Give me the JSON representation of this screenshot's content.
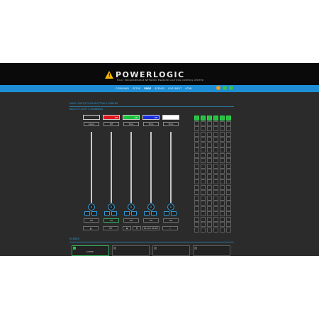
{
  "header": {
    "brand": "POWERLOGIC",
    "tagline": "FULLY PROGRAMMABLE NETWORK ENABLED LIGHTING CONTROL CENTER",
    "logo_mark": "warning-triangle-icon",
    "accent": "#1e8fd6"
  },
  "nav": {
    "items": [
      {
        "label": "COMMAND"
      },
      {
        "label": "SETUP"
      },
      {
        "label": "FADE",
        "active": true
      },
      {
        "label": "SCENES"
      },
      {
        "label": "LIVE INPUT"
      },
      {
        "label": "HTML"
      }
    ]
  },
  "social": [
    {
      "name": "facebook-icon",
      "color": "#f0a020"
    },
    {
      "name": "twitter-icon",
      "color": "#3cc04a"
    },
    {
      "name": "google-icon",
      "color": "#3cc04a"
    }
  ],
  "sections": {
    "top_title": "FADE LIGHT/COLOR BUTTON & FADERS",
    "top_subtitle": "SELECT LIGHT / CHANNELS",
    "bottom_title": "SCENES"
  },
  "channels": [
    {
      "color": "#2b2b2b",
      "color_label": "",
      "select_label": "Apply",
      "knob": "0",
      "button": "Off"
    },
    {
      "color": "#e0141e",
      "color_label": "Off",
      "select_label": "Off",
      "knob": "0",
      "button": "Off"
    },
    {
      "color": "#18c23c",
      "color_label": "Off",
      "select_label": "Stop",
      "knob": "0",
      "button": "Off"
    },
    {
      "color": "#1a2ee0",
      "color_label": "Off",
      "select_label": "Stop",
      "knob": "0",
      "button": "Off"
    },
    {
      "color": "#ffffff",
      "color_label": "",
      "select_label": "Stop",
      "knob": "0",
      "button": "Off"
    }
  ],
  "bottom_buttons": {
    "b1": "▲",
    "b2": "Off",
    "b3": "◆",
    "b4": "▼",
    "b5": "BLACK MODE",
    "b6": "◇"
  },
  "grid": {
    "columns": 6,
    "rows": 22,
    "active_cells": 6
  },
  "scenes": [
    {
      "label": "SCENE",
      "active": true
    },
    {
      "label": "",
      "active": false
    },
    {
      "label": "",
      "active": false
    },
    {
      "label": "",
      "active": false
    }
  ]
}
